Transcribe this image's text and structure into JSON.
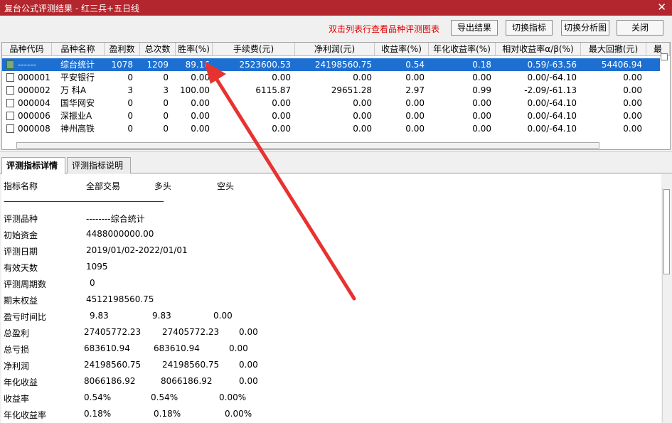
{
  "window": {
    "title": "复台公式评测结果 - 红三兵+五日线"
  },
  "toolbar": {
    "hint": "双击列表行查看品种评测图表",
    "export_label": "导出结果",
    "switch_indicator_label": "切换指标",
    "switch_chart_label": "切换分析图",
    "close_label": "关闭"
  },
  "table": {
    "columns": [
      "品种代码",
      "品种名称",
      "盈利数",
      "总次数",
      "胜率(%)",
      "手续费(元)",
      "净利润(元)",
      "收益率(%)",
      "年化收益率(%)",
      "相对收益率α/β(%)",
      "最大回撤(元)",
      "最"
    ],
    "rows": [
      {
        "code": "------",
        "name": "综台统计",
        "wins": "1078",
        "total": "1209",
        "winrate": "89.16",
        "fee": "2523600.53",
        "profit": "24198560.75",
        "ret": "0.54",
        "annual": "0.18",
        "relative": "0.59/-63.56",
        "drawdown": "54406.94",
        "selected": true
      },
      {
        "code": "000001",
        "name": "平安银行",
        "wins": "0",
        "total": "0",
        "winrate": "0.00",
        "fee": "0.00",
        "profit": "0.00",
        "ret": "0.00",
        "annual": "0.00",
        "relative": "0.00/-64.10",
        "drawdown": "0.00"
      },
      {
        "code": "000002",
        "name": "万 科A",
        "wins": "3",
        "total": "3",
        "winrate": "100.00",
        "fee": "6115.87",
        "profit": "29651.28",
        "ret": "2.97",
        "annual": "0.99",
        "relative": "-2.09/-61.13",
        "drawdown": "0.00"
      },
      {
        "code": "000004",
        "name": "国华网安",
        "wins": "0",
        "total": "0",
        "winrate": "0.00",
        "fee": "0.00",
        "profit": "0.00",
        "ret": "0.00",
        "annual": "0.00",
        "relative": "0.00/-64.10",
        "drawdown": "0.00"
      },
      {
        "code": "000006",
        "name": "深振业A",
        "wins": "0",
        "total": "0",
        "winrate": "0.00",
        "fee": "0.00",
        "profit": "0.00",
        "ret": "0.00",
        "annual": "0.00",
        "relative": "0.00/-64.10",
        "drawdown": "0.00"
      },
      {
        "code": "000008",
        "name": "神州高铁",
        "wins": "0",
        "total": "0",
        "winrate": "0.00",
        "fee": "0.00",
        "profit": "0.00",
        "ret": "0.00",
        "annual": "0.00",
        "relative": "0.00/-64.10",
        "drawdown": "0.00"
      }
    ]
  },
  "tabs": {
    "detail_label": "评测指标详情",
    "desc_label": "评测指标说明"
  },
  "detail": {
    "header": [
      "指标名称",
      "全部交易",
      "多头",
      "空头"
    ],
    "separator": "------------------------------------------------------------------------------------------------",
    "lines": [
      {
        "label": "评测品种",
        "values": [
          "--------综合统计"
        ]
      },
      {
        "label": "初始资金",
        "values": [
          "4488000000.00"
        ]
      },
      {
        "label": "评测日期",
        "values": [
          "2019/01/02-2022/01/01"
        ]
      },
      {
        "label": "有效天数",
        "values": [
          "1095"
        ]
      },
      {
        "label": "评测周期数",
        "values": [
          "0"
        ]
      },
      {
        "label": "期末权益",
        "values": [
          "4512198560.75"
        ]
      },
      {
        "label": "盈亏时间比",
        "values": [
          "9.83",
          "9.83",
          "0.00"
        ]
      },
      {
        "label": "总盈利",
        "values": [
          "27405772.23",
          "27405772.23",
          "0.00"
        ]
      },
      {
        "label": "总亏损",
        "values": [
          "683610.94",
          "683610.94",
          "0.00"
        ]
      },
      {
        "label": "净利润",
        "values": [
          "24198560.75",
          "24198560.75",
          "0.00"
        ]
      },
      {
        "label": "年化收益",
        "values": [
          "8066186.92",
          "8066186.92",
          "0.00"
        ]
      },
      {
        "label": "收益率",
        "values": [
          "0.54%",
          "0.54%",
          "0.00%"
        ]
      },
      {
        "label": "年化收益率",
        "values": [
          "0.18%",
          "0.18%",
          "0.00%"
        ]
      }
    ]
  },
  "colors": {
    "titlebar": "#b3262d",
    "hint": "#e00000",
    "selection": "#1e6fd2",
    "arrow": "#e8322f"
  }
}
